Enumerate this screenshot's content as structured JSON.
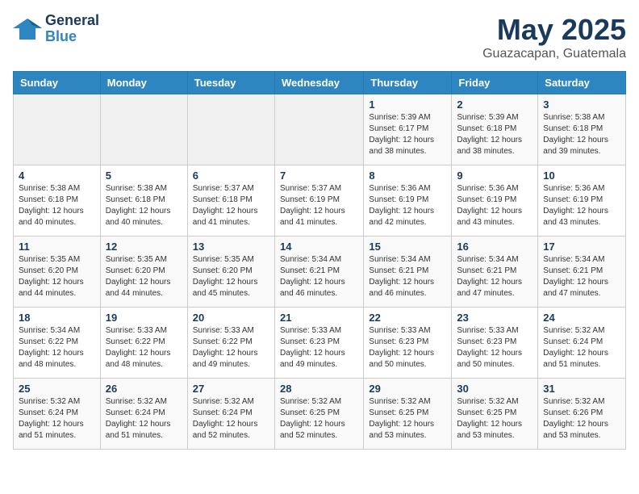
{
  "logo": {
    "line1": "General",
    "line2": "Blue"
  },
  "header": {
    "month": "May 2025",
    "location": "Guazacapan, Guatemala"
  },
  "weekdays": [
    "Sunday",
    "Monday",
    "Tuesday",
    "Wednesday",
    "Thursday",
    "Friday",
    "Saturday"
  ],
  "weeks": [
    [
      {
        "day": "",
        "info": ""
      },
      {
        "day": "",
        "info": ""
      },
      {
        "day": "",
        "info": ""
      },
      {
        "day": "",
        "info": ""
      },
      {
        "day": "1",
        "info": "Sunrise: 5:39 AM\nSunset: 6:17 PM\nDaylight: 12 hours\nand 38 minutes."
      },
      {
        "day": "2",
        "info": "Sunrise: 5:39 AM\nSunset: 6:18 PM\nDaylight: 12 hours\nand 38 minutes."
      },
      {
        "day": "3",
        "info": "Sunrise: 5:38 AM\nSunset: 6:18 PM\nDaylight: 12 hours\nand 39 minutes."
      }
    ],
    [
      {
        "day": "4",
        "info": "Sunrise: 5:38 AM\nSunset: 6:18 PM\nDaylight: 12 hours\nand 40 minutes."
      },
      {
        "day": "5",
        "info": "Sunrise: 5:38 AM\nSunset: 6:18 PM\nDaylight: 12 hours\nand 40 minutes."
      },
      {
        "day": "6",
        "info": "Sunrise: 5:37 AM\nSunset: 6:18 PM\nDaylight: 12 hours\nand 41 minutes."
      },
      {
        "day": "7",
        "info": "Sunrise: 5:37 AM\nSunset: 6:19 PM\nDaylight: 12 hours\nand 41 minutes."
      },
      {
        "day": "8",
        "info": "Sunrise: 5:36 AM\nSunset: 6:19 PM\nDaylight: 12 hours\nand 42 minutes."
      },
      {
        "day": "9",
        "info": "Sunrise: 5:36 AM\nSunset: 6:19 PM\nDaylight: 12 hours\nand 43 minutes."
      },
      {
        "day": "10",
        "info": "Sunrise: 5:36 AM\nSunset: 6:19 PM\nDaylight: 12 hours\nand 43 minutes."
      }
    ],
    [
      {
        "day": "11",
        "info": "Sunrise: 5:35 AM\nSunset: 6:20 PM\nDaylight: 12 hours\nand 44 minutes."
      },
      {
        "day": "12",
        "info": "Sunrise: 5:35 AM\nSunset: 6:20 PM\nDaylight: 12 hours\nand 44 minutes."
      },
      {
        "day": "13",
        "info": "Sunrise: 5:35 AM\nSunset: 6:20 PM\nDaylight: 12 hours\nand 45 minutes."
      },
      {
        "day": "14",
        "info": "Sunrise: 5:34 AM\nSunset: 6:21 PM\nDaylight: 12 hours\nand 46 minutes."
      },
      {
        "day": "15",
        "info": "Sunrise: 5:34 AM\nSunset: 6:21 PM\nDaylight: 12 hours\nand 46 minutes."
      },
      {
        "day": "16",
        "info": "Sunrise: 5:34 AM\nSunset: 6:21 PM\nDaylight: 12 hours\nand 47 minutes."
      },
      {
        "day": "17",
        "info": "Sunrise: 5:34 AM\nSunset: 6:21 PM\nDaylight: 12 hours\nand 47 minutes."
      }
    ],
    [
      {
        "day": "18",
        "info": "Sunrise: 5:34 AM\nSunset: 6:22 PM\nDaylight: 12 hours\nand 48 minutes."
      },
      {
        "day": "19",
        "info": "Sunrise: 5:33 AM\nSunset: 6:22 PM\nDaylight: 12 hours\nand 48 minutes."
      },
      {
        "day": "20",
        "info": "Sunrise: 5:33 AM\nSunset: 6:22 PM\nDaylight: 12 hours\nand 49 minutes."
      },
      {
        "day": "21",
        "info": "Sunrise: 5:33 AM\nSunset: 6:23 PM\nDaylight: 12 hours\nand 49 minutes."
      },
      {
        "day": "22",
        "info": "Sunrise: 5:33 AM\nSunset: 6:23 PM\nDaylight: 12 hours\nand 50 minutes."
      },
      {
        "day": "23",
        "info": "Sunrise: 5:33 AM\nSunset: 6:23 PM\nDaylight: 12 hours\nand 50 minutes."
      },
      {
        "day": "24",
        "info": "Sunrise: 5:32 AM\nSunset: 6:24 PM\nDaylight: 12 hours\nand 51 minutes."
      }
    ],
    [
      {
        "day": "25",
        "info": "Sunrise: 5:32 AM\nSunset: 6:24 PM\nDaylight: 12 hours\nand 51 minutes."
      },
      {
        "day": "26",
        "info": "Sunrise: 5:32 AM\nSunset: 6:24 PM\nDaylight: 12 hours\nand 51 minutes."
      },
      {
        "day": "27",
        "info": "Sunrise: 5:32 AM\nSunset: 6:24 PM\nDaylight: 12 hours\nand 52 minutes."
      },
      {
        "day": "28",
        "info": "Sunrise: 5:32 AM\nSunset: 6:25 PM\nDaylight: 12 hours\nand 52 minutes."
      },
      {
        "day": "29",
        "info": "Sunrise: 5:32 AM\nSunset: 6:25 PM\nDaylight: 12 hours\nand 53 minutes."
      },
      {
        "day": "30",
        "info": "Sunrise: 5:32 AM\nSunset: 6:25 PM\nDaylight: 12 hours\nand 53 minutes."
      },
      {
        "day": "31",
        "info": "Sunrise: 5:32 AM\nSunset: 6:26 PM\nDaylight: 12 hours\nand 53 minutes."
      }
    ]
  ]
}
